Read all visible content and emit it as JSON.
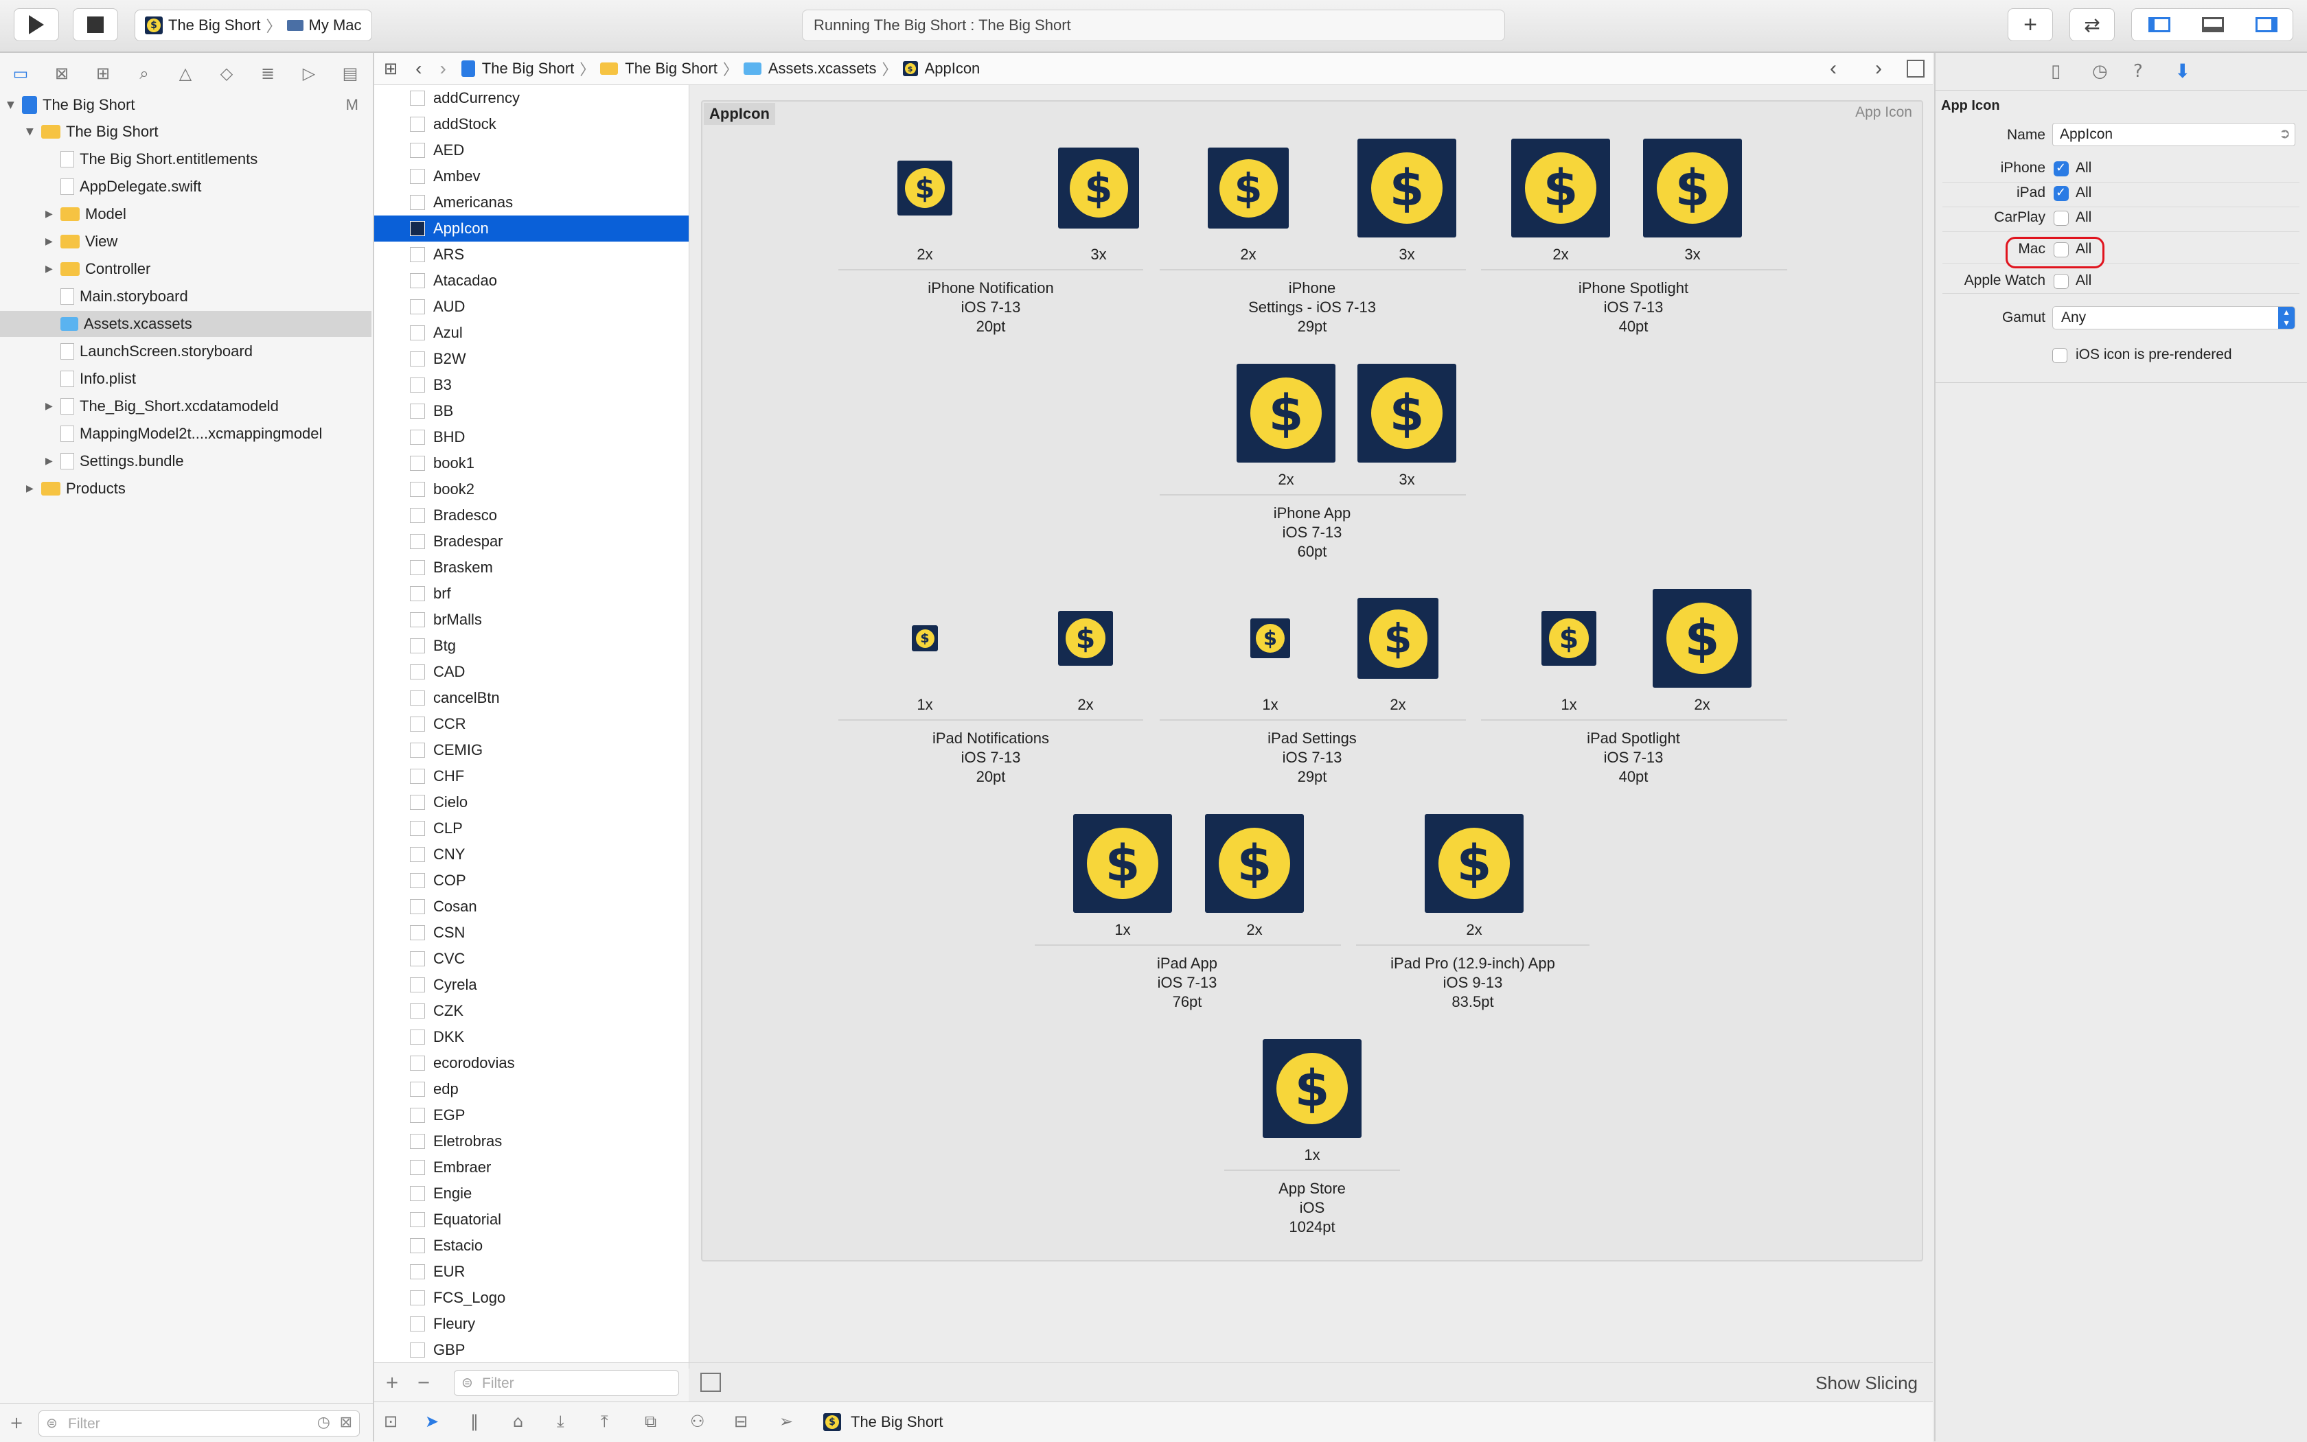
{
  "toolbar": {
    "scheme": "The Big Short",
    "destination": "My Mac",
    "status": "Running The Big Short : The Big Short",
    "play_icon": "play-icon",
    "stop_icon": "stop-icon"
  },
  "navigator": {
    "root": "The Big Short",
    "root_badge": "M",
    "items": [
      {
        "label": "The Big Short",
        "kind": "folder",
        "level": 1,
        "tri": "▼"
      },
      {
        "label": "The Big Short.entitlements",
        "kind": "file",
        "level": 2
      },
      {
        "label": "AppDelegate.swift",
        "kind": "file",
        "level": 2
      },
      {
        "label": "Model",
        "kind": "folder",
        "level": 2,
        "tri": "▶"
      },
      {
        "label": "View",
        "kind": "folder",
        "level": 2,
        "tri": "▶"
      },
      {
        "label": "Controller",
        "kind": "folder",
        "level": 2,
        "tri": "▶"
      },
      {
        "label": "Main.storyboard",
        "kind": "file",
        "level": 2
      },
      {
        "label": "Assets.xcassets",
        "kind": "assets",
        "level": 2,
        "selected": true
      },
      {
        "label": "LaunchScreen.storyboard",
        "kind": "file",
        "level": 2
      },
      {
        "label": "Info.plist",
        "kind": "file",
        "level": 2
      },
      {
        "label": "The_Big_Short.xcdatamodeld",
        "kind": "file",
        "level": 2,
        "tri": "▶"
      },
      {
        "label": "MappingModel2t....xcmappingmodel",
        "kind": "file",
        "level": 2
      },
      {
        "label": "Settings.bundle",
        "kind": "file",
        "level": 2,
        "tri": "▶"
      },
      {
        "label": "Products",
        "kind": "folder",
        "level": 1,
        "tri": "▶"
      }
    ],
    "filter_placeholder": "Filter"
  },
  "jumpbar": [
    "The Big Short",
    "The Big Short",
    "Assets.xcassets",
    "AppIcon"
  ],
  "assets": {
    "items": [
      "addCurrency",
      "addStock",
      "AED",
      "Ambev",
      "Americanas",
      "AppIcon",
      "ARS",
      "Atacadao",
      "AUD",
      "Azul",
      "B2W",
      "B3",
      "BB",
      "BHD",
      "book1",
      "book2",
      "Bradesco",
      "Bradespar",
      "Braskem",
      "brf",
      "brMalls",
      "Btg",
      "CAD",
      "cancelBtn",
      "CCR",
      "CEMIG",
      "CHF",
      "Cielo",
      "CLP",
      "CNY",
      "COP",
      "Cosan",
      "CSN",
      "CVC",
      "Cyrela",
      "CZK",
      "DKK",
      "ecorodovias",
      "edp",
      "EGP",
      "Eletrobras",
      "Embraer",
      "Engie",
      "Equatorial",
      "Estacio",
      "EUR",
      "FCS_Logo",
      "Fleury",
      "GBP"
    ],
    "selected": "AppIcon",
    "filter_placeholder": "Filter"
  },
  "editor": {
    "set_name": "AppIcon",
    "set_type": "App Icon",
    "show_slicing": "Show Slicing",
    "groups": [
      {
        "name": "iPhone Notification",
        "os": "iOS 7-13",
        "size": "20pt",
        "scales": [
          "2x",
          "3x"
        ]
      },
      {
        "name": "iPhone",
        "name2": "Settings - iOS 7-13",
        "size": "29pt",
        "scales": [
          "2x",
          "3x"
        ]
      },
      {
        "name": "iPhone Spotlight",
        "os": "iOS 7-13",
        "size": "40pt",
        "scales": [
          "2x",
          "3x"
        ]
      },
      {
        "name": "iPhone App",
        "os": "iOS 7-13",
        "size": "60pt",
        "scales": [
          "2x",
          "3x"
        ]
      },
      {
        "name": "iPad Notifications",
        "os": "iOS 7-13",
        "size": "20pt",
        "scales": [
          "1x",
          "2x"
        ]
      },
      {
        "name": "iPad Settings",
        "os": "iOS 7-13",
        "size": "29pt",
        "scales": [
          "1x",
          "2x"
        ]
      },
      {
        "name": "iPad Spotlight",
        "os": "iOS 7-13",
        "size": "40pt",
        "scales": [
          "1x",
          "2x"
        ]
      },
      {
        "name": "iPad App",
        "os": "iOS 7-13",
        "size": "76pt",
        "scales": [
          "1x",
          "2x"
        ]
      },
      {
        "name": "iPad Pro (12.9-inch) App",
        "os": "iOS 9-13",
        "size": "83.5pt",
        "scales": [
          "2x"
        ]
      },
      {
        "name": "App Store",
        "os": "iOS",
        "size": "1024pt",
        "scales": [
          "1x"
        ]
      }
    ]
  },
  "inspector": {
    "section": "App Icon",
    "name_label": "Name",
    "name_value": "AppIcon",
    "devices": [
      {
        "label": "iPhone",
        "checked": true,
        "value": "All"
      },
      {
        "label": "iPad",
        "checked": true,
        "value": "All"
      },
      {
        "label": "CarPlay",
        "checked": false,
        "value": "All"
      },
      {
        "label": "Mac",
        "checked": false,
        "value": "All"
      },
      {
        "label": "Apple Watch",
        "checked": false,
        "value": "All"
      }
    ],
    "gamut_label": "Gamut",
    "gamut_value": "Any",
    "prerendered": "iOS icon is pre-rendered"
  },
  "debugbar": {
    "process": "The Big Short"
  },
  "colors": {
    "accent": "#0a60d8",
    "icon_bg": "#142a4f",
    "coin": "#f7d63a",
    "highlight": "#e0141e"
  }
}
